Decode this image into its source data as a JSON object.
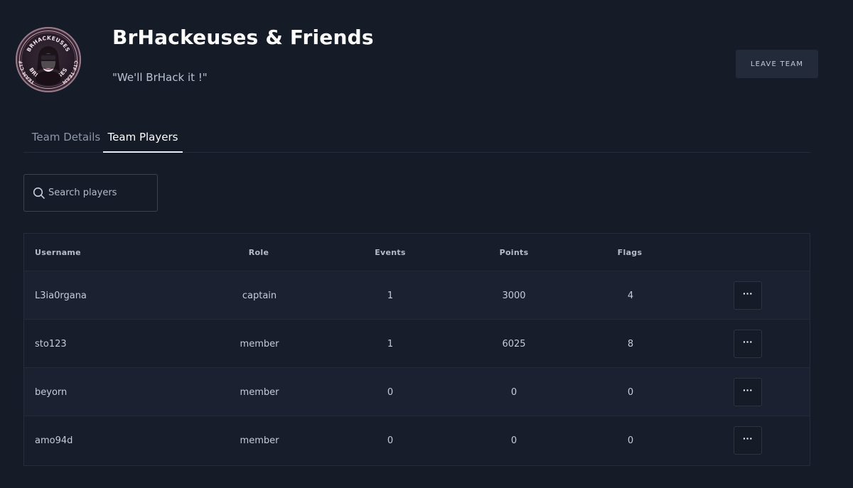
{
  "team": {
    "name": "BrHackeuses & Friends",
    "motto": "\"We'll BrHack it !\"",
    "logo_text_top": "BRHACKEUSES",
    "logo_text_bottom": "BRHACKEUSES",
    "logo_text_left": "TEAM CTF",
    "logo_text_right": "CTF TEAM"
  },
  "actions": {
    "leave_label": "LEAVE TEAM"
  },
  "tabs": [
    {
      "label": "Team Details",
      "active": false
    },
    {
      "label": "Team Players",
      "active": true
    }
  ],
  "search": {
    "placeholder": "Search players",
    "value": ""
  },
  "table": {
    "headers": [
      "Username",
      "Role",
      "Events",
      "Points",
      "Flags"
    ],
    "rows": [
      {
        "username": "L3ia0rgana",
        "role": "captain",
        "events": "1",
        "points": "3000",
        "flags": "4",
        "menu": "···"
      },
      {
        "username": "sto123",
        "role": "member",
        "events": "1",
        "points": "6025",
        "flags": "8",
        "menu": "···"
      },
      {
        "username": "beyorn",
        "role": "member",
        "events": "0",
        "points": "0",
        "flags": "0",
        "menu": "···"
      },
      {
        "username": "amo94d",
        "role": "member",
        "events": "0",
        "points": "0",
        "flags": "0",
        "menu": "···"
      }
    ]
  },
  "colors": {
    "background": "#151b27",
    "accent": "#ffffff",
    "muted_text": "#8e98ab"
  }
}
